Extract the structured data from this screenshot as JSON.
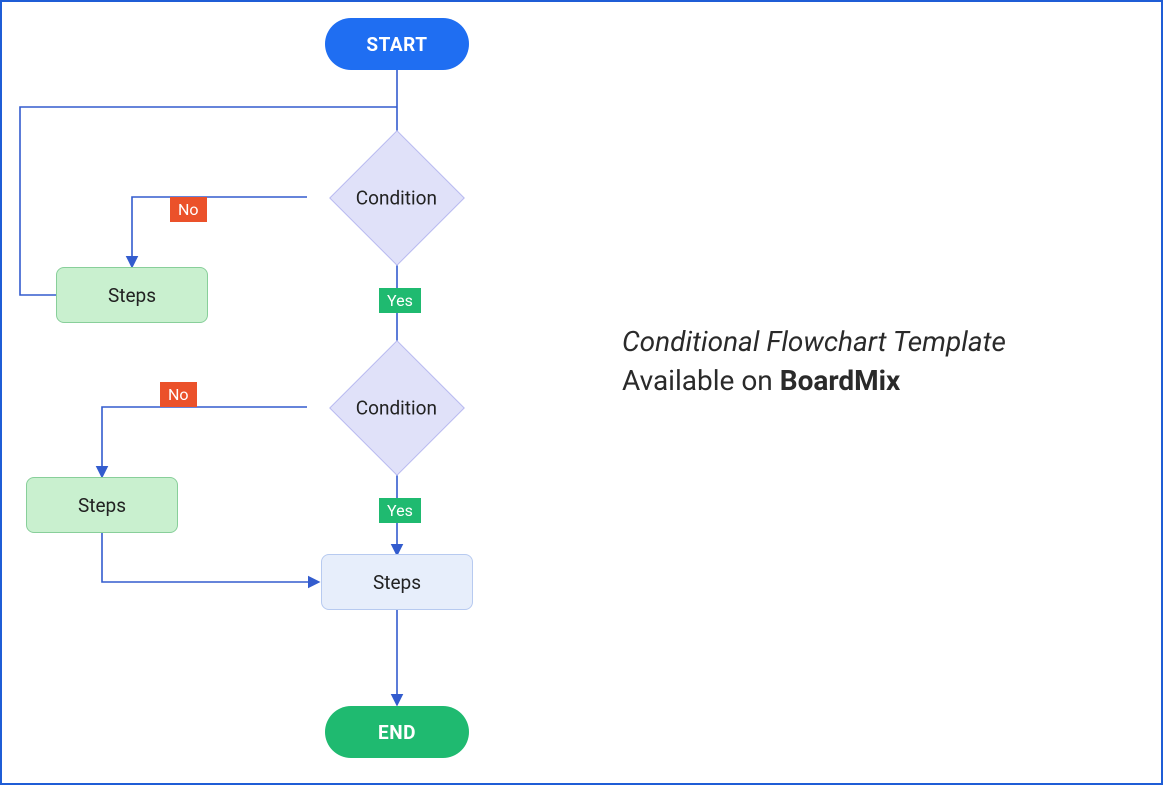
{
  "flowchart": {
    "start": "START",
    "condition1": "Condition",
    "condition1_no": "No",
    "condition1_yes": "Yes",
    "steps1": "Steps",
    "condition2": "Condition",
    "condition2_no": "No",
    "condition2_yes": "Yes",
    "steps2": "Steps",
    "steps3": "Steps",
    "end": "END"
  },
  "caption": {
    "line1": "Conditional Flowchart Template",
    "line2_prefix": "Available on ",
    "line2_brand": "BoardMix"
  },
  "colors": {
    "border": "#1f5dd6",
    "connector": "#335cce",
    "start": "#1f6ef2",
    "end": "#1fba70",
    "condition_fill": "#e0e1f9",
    "process_green": "#c9f0cf",
    "process_blue": "#e7eefb",
    "no_tag": "#eb512a",
    "yes_tag": "#1fba70"
  }
}
